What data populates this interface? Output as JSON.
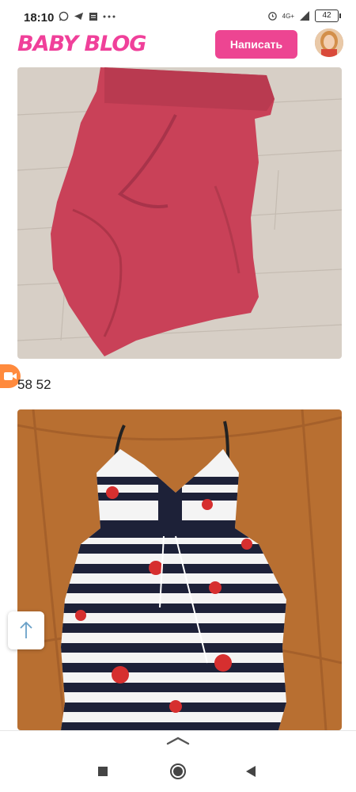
{
  "status_bar": {
    "time": "18:10",
    "network": "4G+",
    "battery": "42",
    "icons": [
      "whatsapp-icon",
      "telegram-icon",
      "message-icon",
      "more-icon",
      "alarm-icon",
      "signal-icon",
      "battery-icon"
    ]
  },
  "header": {
    "logo": "BABY BLOG",
    "write_button": "Написать",
    "accent_color": "#ed4592"
  },
  "post": {
    "caption": "58 52",
    "images": [
      "red-shorts-photo",
      "striped-nautical-dress-photo"
    ]
  },
  "controls": {
    "scroll_top_icon": "arrow-up-icon",
    "video_icon": "video-camera-icon",
    "sheet_icon": "chevron-up-icon"
  },
  "nav": {
    "items": [
      "recents-icon",
      "home-icon",
      "back-icon"
    ]
  }
}
